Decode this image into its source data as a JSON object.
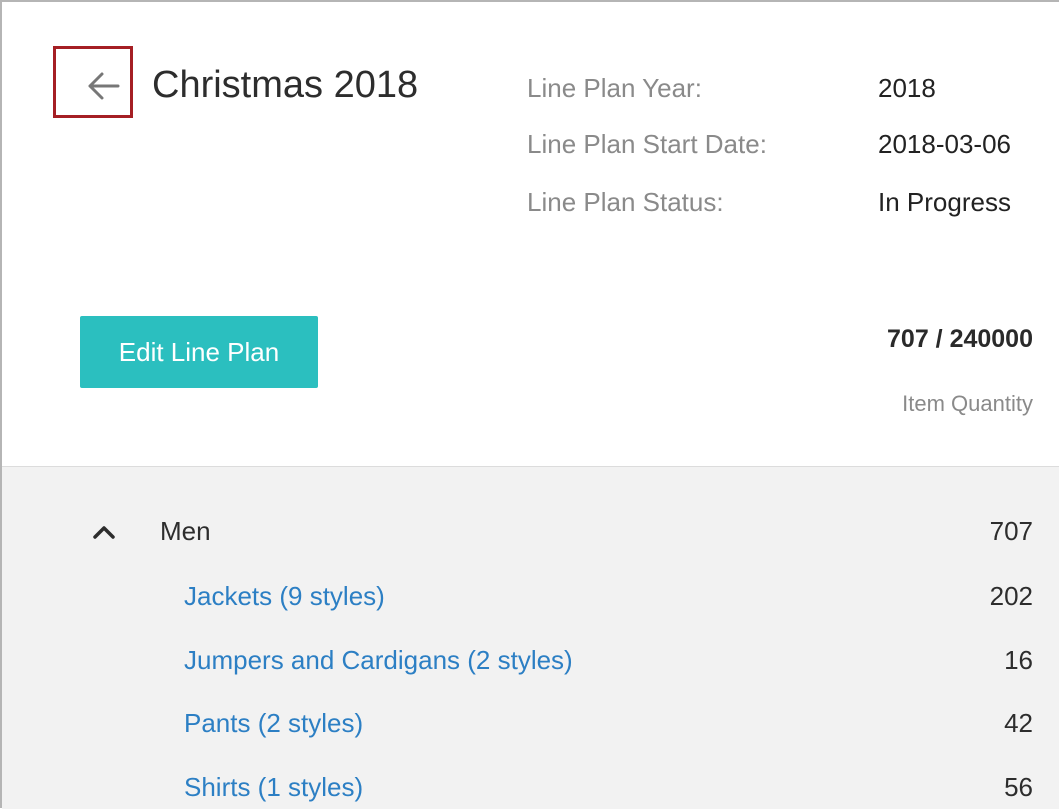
{
  "header": {
    "title": "Christmas 2018",
    "back_icon": "arrow-left-icon"
  },
  "meta": [
    {
      "label": "Line Plan Year:",
      "value": "2018"
    },
    {
      "label": "Line Plan Start Date:",
      "value": "2018-03-06"
    },
    {
      "label": "Line Plan Status:",
      "value": "In Progress"
    }
  ],
  "actions": {
    "edit_label": "Edit Line Plan"
  },
  "quantity": {
    "value": "707 / 240000",
    "label": "Item Quantity"
  },
  "category": {
    "label": "Men",
    "qty": "707",
    "icon": "chevron-up-icon"
  },
  "subcategories": [
    {
      "label": "Jackets (9 styles)",
      "qty": "202"
    },
    {
      "label": "Jumpers and Cardigans (2 styles)",
      "qty": "16"
    },
    {
      "label": "Pants (2 styles)",
      "qty": "42"
    },
    {
      "label": "Shirts (1 styles)",
      "qty": "56"
    }
  ],
  "colors": {
    "accent": "#2bbfbf",
    "link": "#2c7fc4",
    "highlight_border": "#a51f24"
  }
}
